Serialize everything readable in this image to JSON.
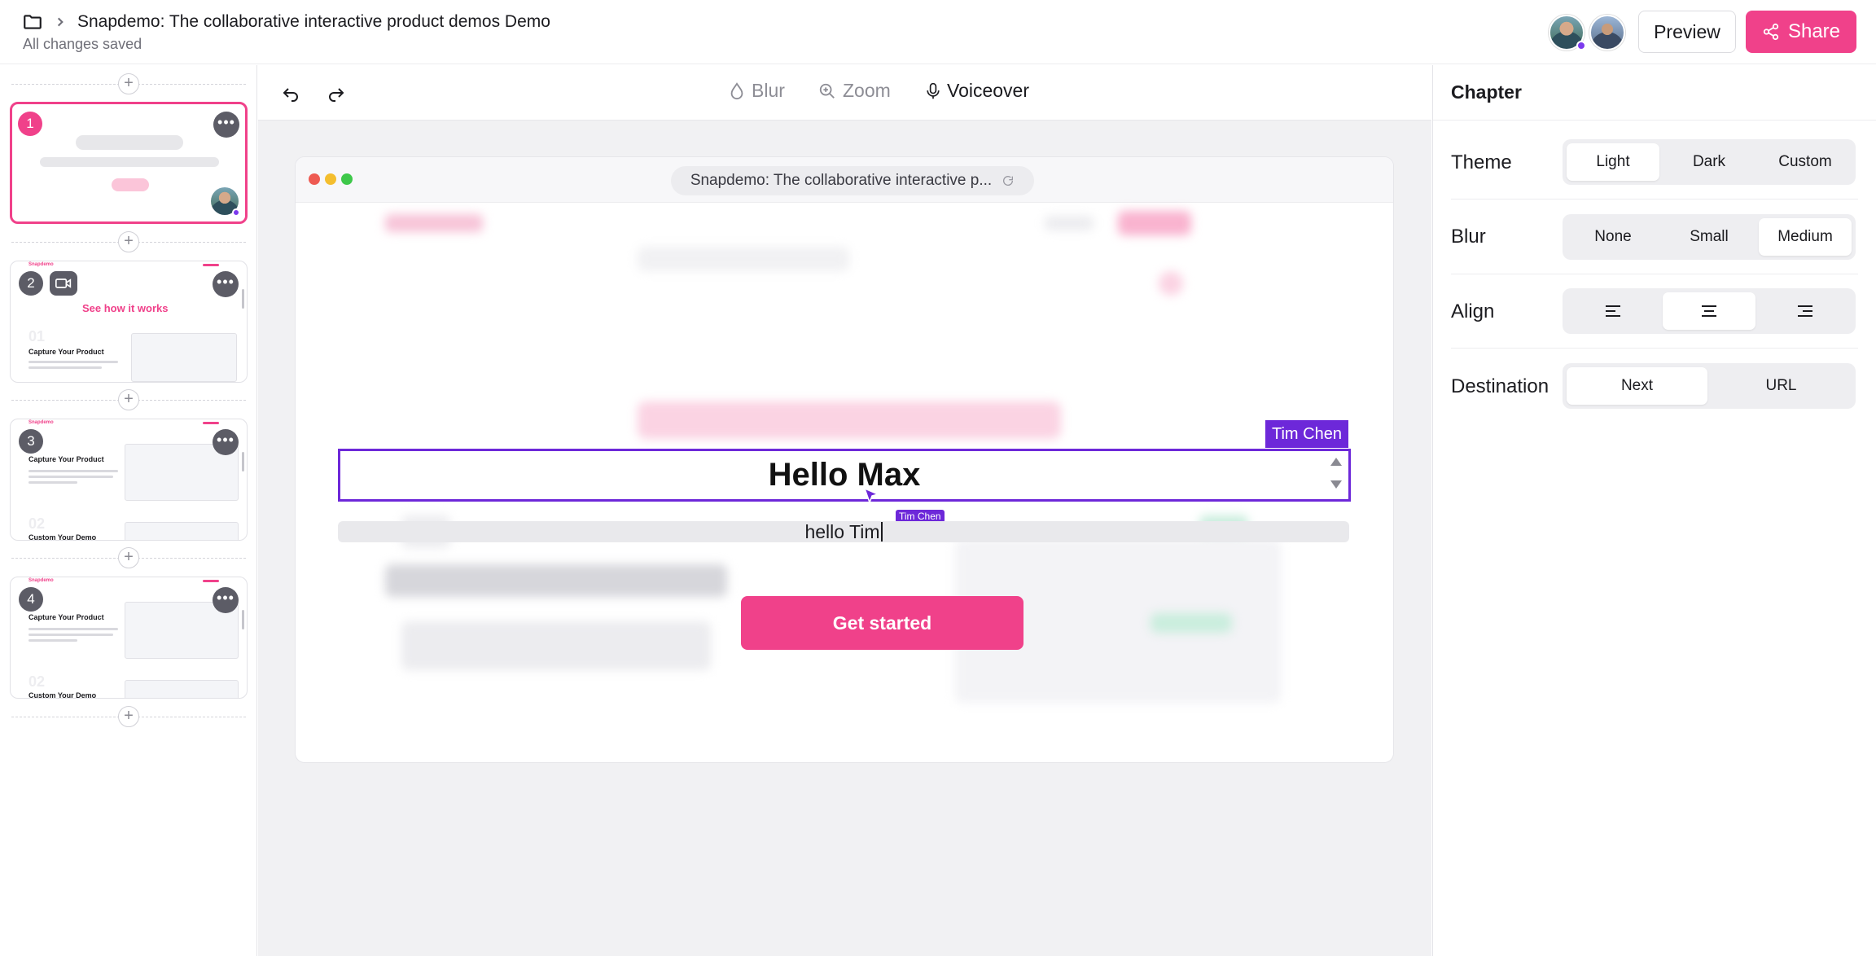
{
  "header": {
    "doc_title": "Snapdemo: The collaborative interactive product demos Demo",
    "save_status": "All changes saved",
    "preview_label": "Preview",
    "share_label": "Share"
  },
  "sidebar": {
    "slides": [
      {
        "number": "1",
        "active": true
      },
      {
        "number": "2",
        "thumb_brand": "Snapdemo",
        "thumb_headline": "See how it works",
        "thumb_step": "01",
        "thumb_title": "Capture Your Product"
      },
      {
        "number": "3",
        "thumb_brand": "Snapdemo",
        "thumb_title": "Capture Your Product",
        "thumb_step": "02",
        "thumb_next": "Custom Your Demo"
      },
      {
        "number": "4",
        "thumb_brand": "Snapdemo",
        "thumb_title": "Capture Your Product",
        "thumb_step": "02",
        "thumb_next": "Custom Your Demo"
      }
    ],
    "add_symbol": "+",
    "more_symbol": "•••"
  },
  "toolbar": {
    "blur_label": "Blur",
    "zoom_label": "Zoom",
    "voiceover_label": "Voiceover"
  },
  "canvas": {
    "url_text": "Snapdemo: The collaborative interactive p...",
    "collaborator_tag": "Tim Chen",
    "cursor_flag": "Tim Chen",
    "heading": "Hello Max",
    "subtext": "hello Tim",
    "cta_label": "Get started"
  },
  "panel": {
    "title": "Chapter",
    "theme": {
      "label": "Theme",
      "options": [
        "Light",
        "Dark",
        "Custom"
      ],
      "selected": "Light"
    },
    "blur": {
      "label": "Blur",
      "options": [
        "None",
        "Small",
        "Medium"
      ],
      "selected": "Medium"
    },
    "align": {
      "label": "Align",
      "options": [
        "left-align-icon",
        "center-align-icon",
        "right-align-icon"
      ],
      "selected": "center-align-icon"
    },
    "destination": {
      "label": "Destination",
      "options": [
        "Next",
        "URL"
      ],
      "selected": "Next"
    }
  },
  "colors": {
    "accent_pink": "#f0418a",
    "collab_purple": "#6d28d9"
  }
}
